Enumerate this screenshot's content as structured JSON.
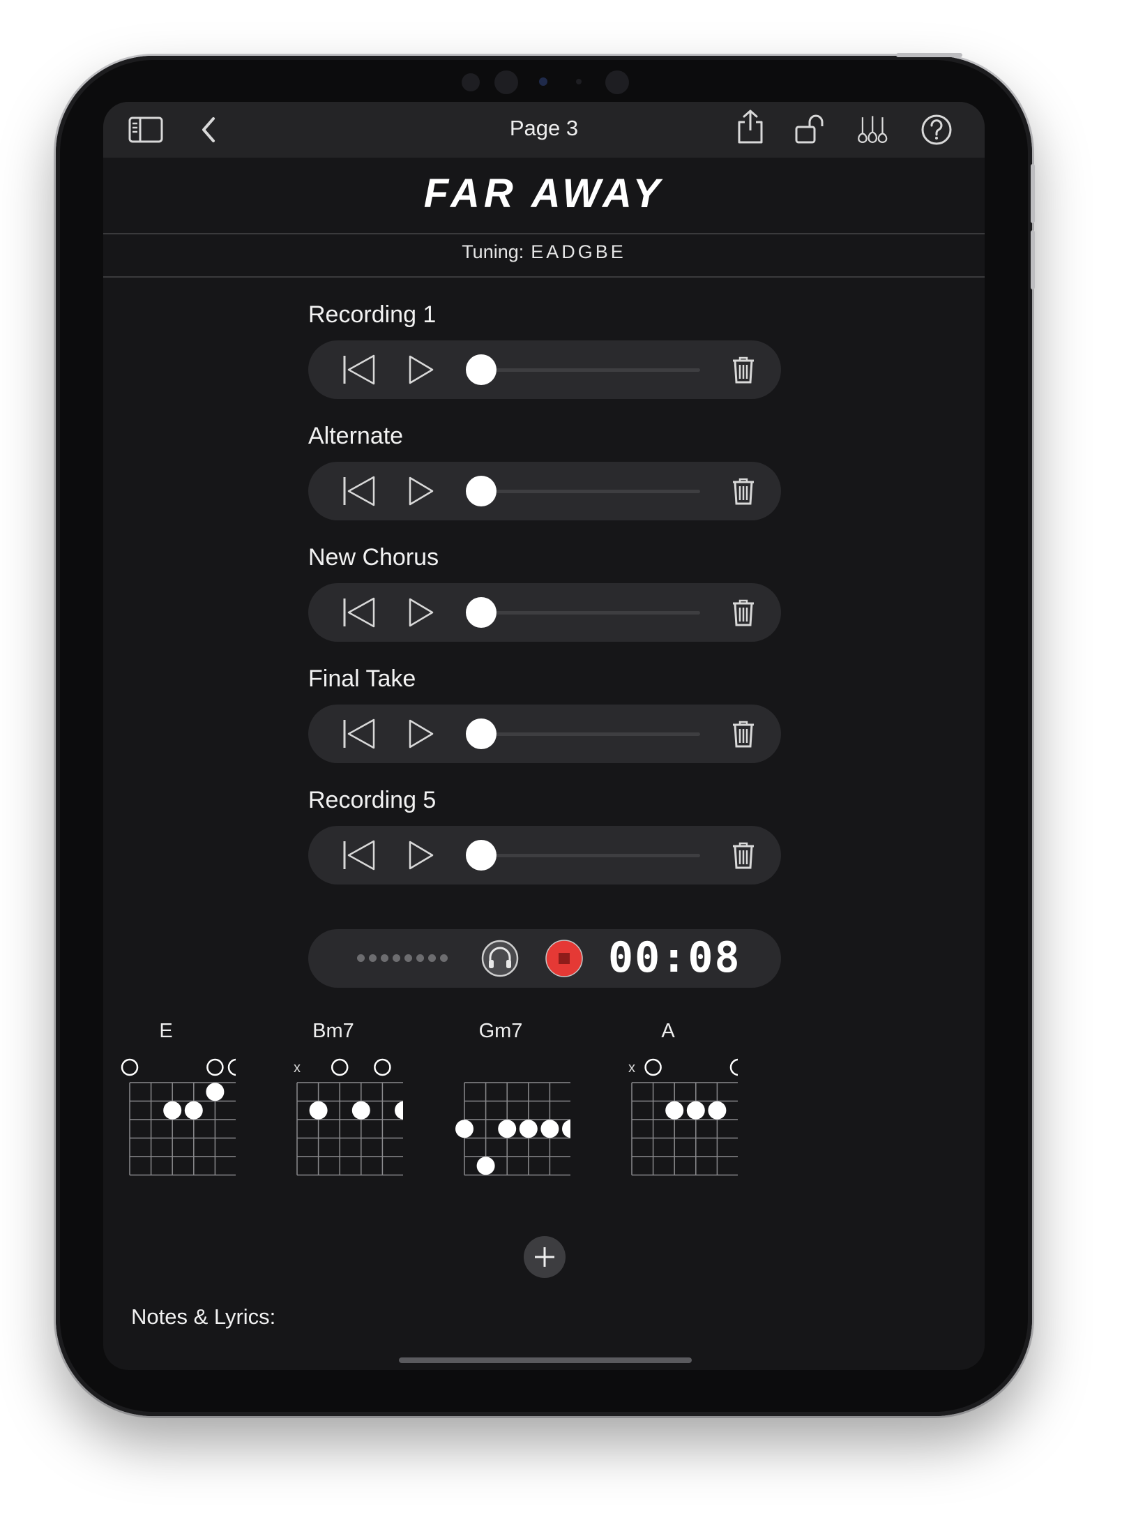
{
  "toolbar": {
    "page_title": "Page 3",
    "icons": [
      "sidebar-icon",
      "back-chevron-icon",
      "share-icon",
      "unlock-icon",
      "instruments-icon",
      "help-icon"
    ]
  },
  "song": {
    "title": "FAR AWAY",
    "tuning_label": "Tuning:",
    "tuning_value": "EADGBE"
  },
  "recordings": [
    {
      "label": "Recording 1",
      "progress": 0
    },
    {
      "label": "Alternate",
      "progress": 0
    },
    {
      "label": "New Chorus",
      "progress": 0
    },
    {
      "label": "Final Take",
      "progress": 0
    },
    {
      "label": "Recording 5",
      "progress": 0
    }
  ],
  "recorder": {
    "timer": "00:08",
    "record_color": "#e53935"
  },
  "chords": [
    {
      "name": "E",
      "markers": [
        "o",
        "",
        "",
        "",
        "o",
        "o"
      ],
      "dots": [
        [
          1,
          4
        ],
        [
          2,
          2
        ],
        [
          2,
          3
        ]
      ]
    },
    {
      "name": "Bm7",
      "markers": [
        "x",
        "",
        "o",
        "",
        "o",
        ""
      ],
      "dots": [
        [
          2,
          1
        ],
        [
          2,
          3
        ],
        [
          2,
          5
        ]
      ]
    },
    {
      "name": "Gm7",
      "markers": [
        "",
        "",
        "",
        "",
        "",
        ""
      ],
      "dots": [
        [
          3,
          0
        ],
        [
          3,
          2
        ],
        [
          3,
          3
        ],
        [
          3,
          4
        ],
        [
          3,
          5
        ],
        [
          5,
          1
        ]
      ]
    },
    {
      "name": "A",
      "markers": [
        "x",
        "o",
        "",
        "",
        "",
        "o"
      ],
      "dots": [
        [
          2,
          2
        ],
        [
          2,
          3
        ],
        [
          2,
          4
        ]
      ]
    }
  ],
  "notes": {
    "label": "Notes & Lyrics:"
  },
  "colors": {
    "background": "#161618",
    "toolbar": "#242426",
    "bar": "#2a2a2d",
    "text": "#f2f2f2",
    "accent_record": "#e53935"
  }
}
